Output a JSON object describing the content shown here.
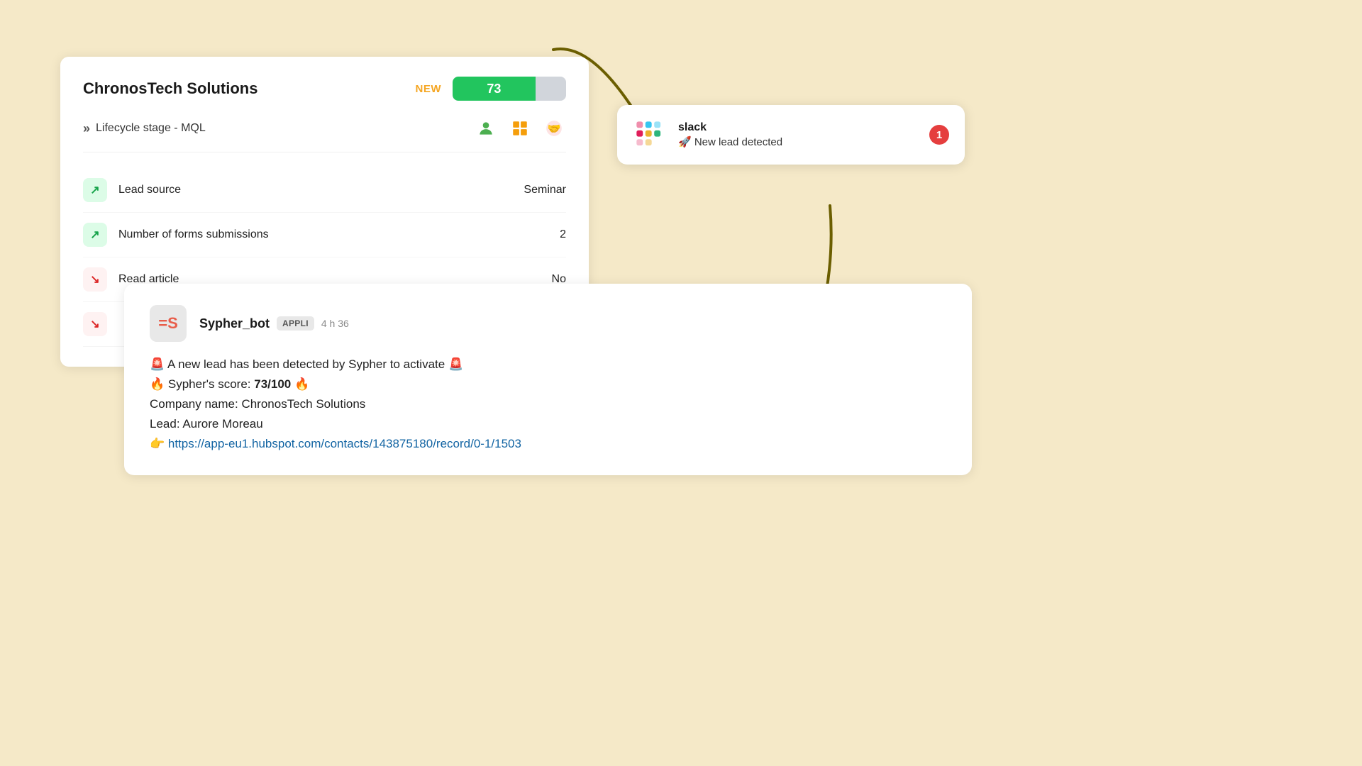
{
  "hubspot": {
    "company_name": "ChronosTech Solutions",
    "status_badge": "NEW",
    "score": "73",
    "lifecycle_label": "Lifecycle stage - MQL",
    "metrics": [
      {
        "name": "Lead source",
        "value": "Seminar",
        "icon_type": "green",
        "icon": "↗"
      },
      {
        "name": "Number of forms submissions",
        "value": "2",
        "icon_type": "green",
        "icon": "↗"
      },
      {
        "name": "Read article",
        "value": "No",
        "icon_type": "red-light",
        "icon": "↘"
      },
      {
        "name": "",
        "value": "",
        "icon_type": "red-light",
        "icon": "↘"
      }
    ]
  },
  "slack_notification": {
    "app_name": "slack",
    "message": "🚀 New lead detected",
    "badge_count": "1"
  },
  "slack_message": {
    "bot_name": "Sypher_bot",
    "bot_badge": "APPLI",
    "time": "4 h 36",
    "line1": "🚨 A new lead has been detected by Sypher to activate 🚨",
    "line2_prefix": "🔥 Sypher's score: ",
    "line2_score": "73/100",
    "line2_suffix": " 🔥",
    "line3": "Company name: ChronosTech Solutions",
    "line4": "Lead: Aurore Moreau",
    "link_prefix": "👉 ",
    "link_url": "https://app-eu1.hubspot.com/contacts/143875180/record/0-1/1503",
    "link_text": "https://app-eu1.hubspot.com/contacts/143875180/record/0-1/1503"
  }
}
